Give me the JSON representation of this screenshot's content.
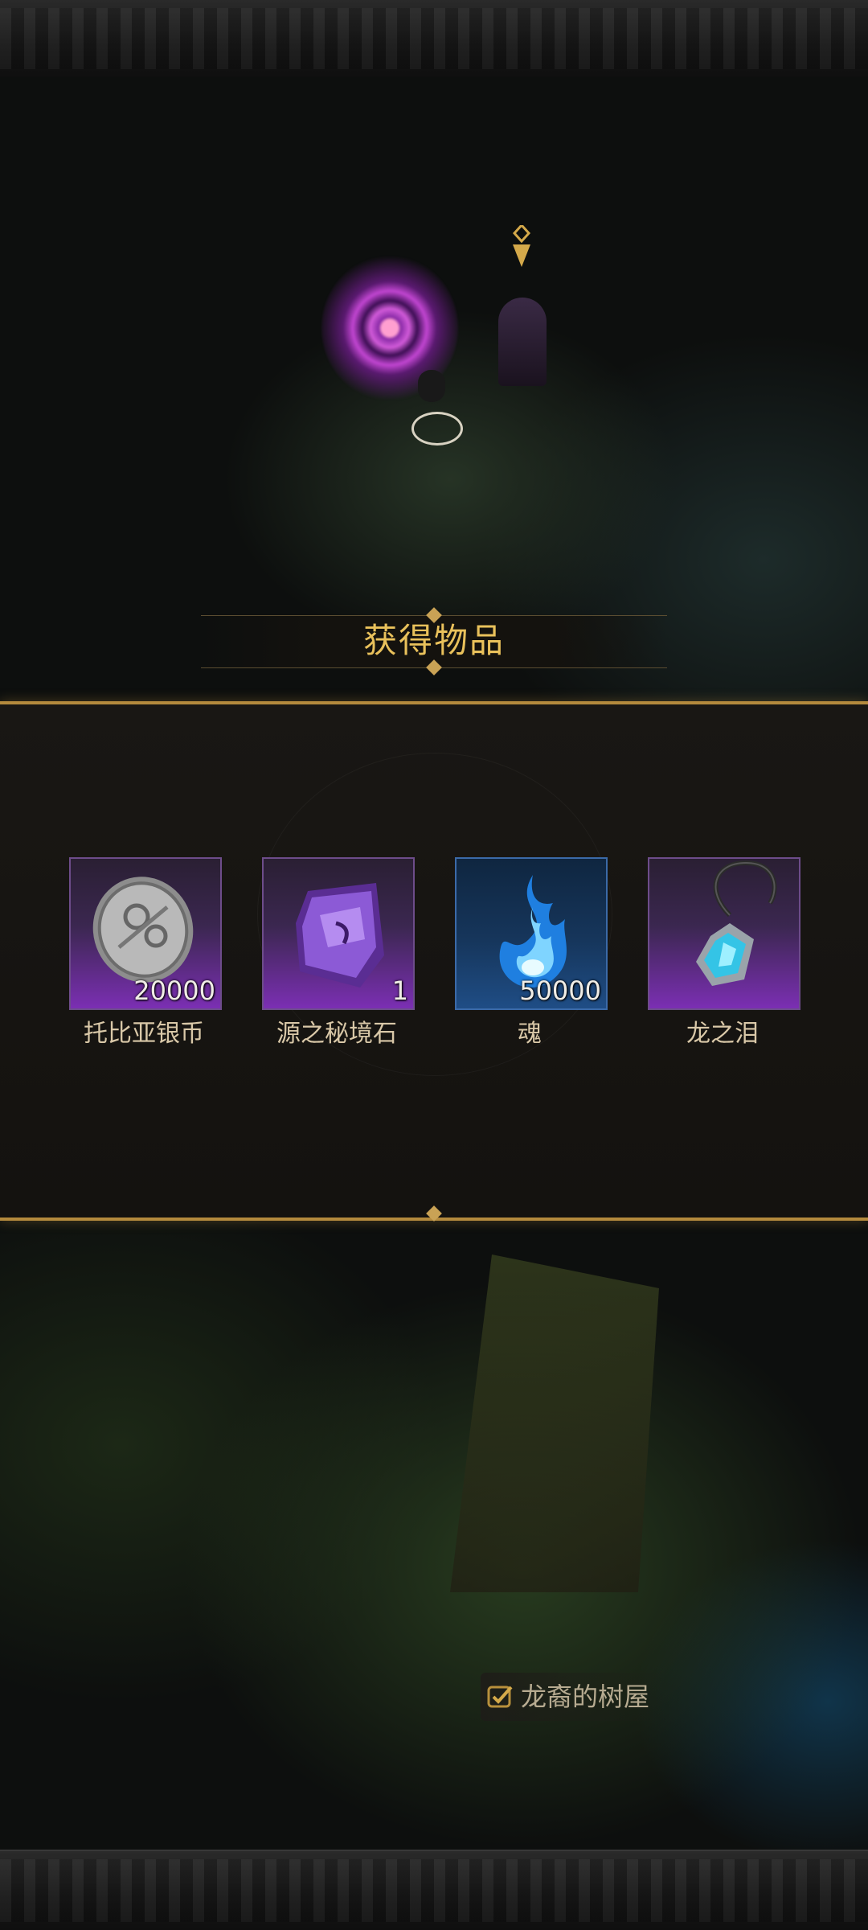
{
  "dialog": {
    "title": "获得物品"
  },
  "rewards": [
    {
      "name": "托比亚银币",
      "quantity": "20000",
      "icon": "silver-coin-icon",
      "slot_color": "#7b2fb3"
    },
    {
      "name": "源之秘境石",
      "quantity": "1",
      "icon": "purple-crystal-icon",
      "slot_color": "#7b2fb3"
    },
    {
      "name": "魂",
      "quantity": "50000",
      "icon": "blue-soul-flame-icon",
      "slot_color": "#1f4d85"
    },
    {
      "name": "龙之泪",
      "quantity": "",
      "icon": "dragon-tear-necklace-icon",
      "slot_color": "#7b2fb3"
    }
  ],
  "location": {
    "label": "龙裔的树屋",
    "icon": "checkmark-icon"
  },
  "colors": {
    "title_gold": "#e9c15b",
    "panel_border": "#b48a3d",
    "item_name": "#d9c8a8"
  }
}
